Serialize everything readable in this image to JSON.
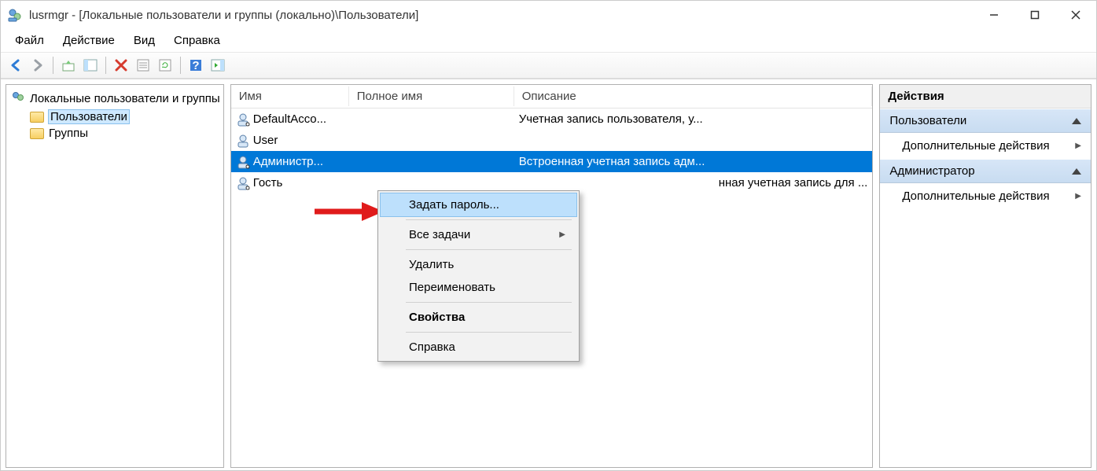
{
  "window": {
    "title": "lusrmgr - [Локальные пользователи и группы (локально)\\Пользователи]"
  },
  "menu": {
    "file": "Файл",
    "action": "Действие",
    "view": "Вид",
    "help": "Справка"
  },
  "tree": {
    "root": "Локальные пользователи и группы",
    "users": "Пользователи",
    "groups": "Группы"
  },
  "columns": {
    "name": "Имя",
    "fullname": "Полное имя",
    "description": "Описание"
  },
  "rows": [
    {
      "name": "DefaultAcco...",
      "full": "",
      "desc": "Учетная запись пользователя, у..."
    },
    {
      "name": "User",
      "full": "",
      "desc": ""
    },
    {
      "name": "Администр...",
      "full": "",
      "desc": "Встроенная учетная запись адм...",
      "selected": true
    },
    {
      "name": "Гость",
      "full": "",
      "desc": "нная учетная запись для ..."
    }
  ],
  "context": {
    "set_password": "Задать пароль...",
    "all_tasks": "Все задачи",
    "delete": "Удалить",
    "rename": "Переименовать",
    "properties": "Свойства",
    "help": "Справка"
  },
  "actions": {
    "title": "Действия",
    "section1": "Пользователи",
    "more1": "Дополнительные действия",
    "section2": "Администратор",
    "more2": "Дополнительные действия"
  }
}
